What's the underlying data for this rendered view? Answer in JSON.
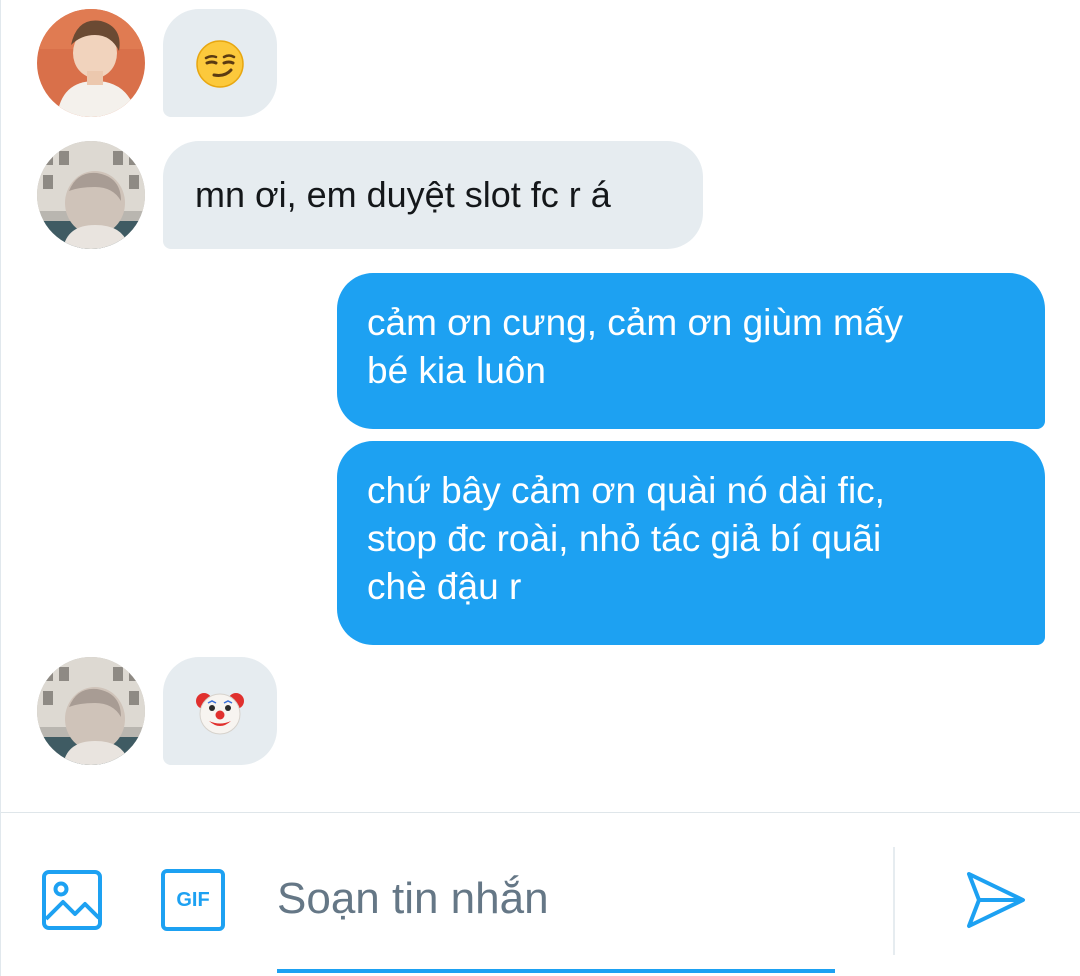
{
  "conversation": {
    "messages": [
      {
        "direction": "incoming",
        "sender_avatar": "avatar-sender-1",
        "content_type": "emoji",
        "emoji": "smirking-face"
      },
      {
        "direction": "incoming",
        "sender_avatar": "avatar-sender-2",
        "content_type": "text",
        "text": "mn ơi, em duyệt slot fc r á"
      },
      {
        "direction": "outgoing",
        "content_type": "text",
        "lines": [
          "cảm ơn cưng, cảm ơn giùm mấy",
          "bé kia luôn"
        ]
      },
      {
        "direction": "outgoing",
        "content_type": "text",
        "lines": [
          "chứ bây cảm ơn quài nó dài fic,",
          "stop đc roài, nhỏ tác giả bí quãi",
          "chè đậu r"
        ]
      },
      {
        "direction": "incoming",
        "sender_avatar": "avatar-sender-2",
        "content_type": "emoji",
        "emoji": "clown-face"
      }
    ]
  },
  "composer": {
    "image_button_icon": "image-icon",
    "gif_button_label": "GIF",
    "placeholder": "Soạn tin nhắn",
    "send_icon": "send-icon"
  },
  "colors": {
    "accent": "#1da1f2",
    "incoming_bubble": "#e6ecf0",
    "text_dark": "#14171a",
    "placeholder": "#657786"
  }
}
